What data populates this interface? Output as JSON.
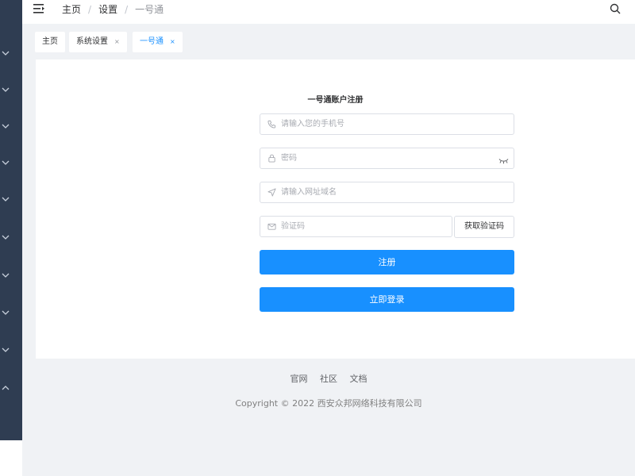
{
  "header": {
    "breadcrumb": [
      "主页",
      "设置",
      "一号通"
    ],
    "separator": "/"
  },
  "tabs": [
    {
      "label": "主页",
      "closable": false
    },
    {
      "label": "系统设置",
      "closable": true,
      "close": "×"
    },
    {
      "label": "一号通",
      "closable": true,
      "close": "×",
      "active": true
    }
  ],
  "form": {
    "title": "一号通账户注册",
    "phone": {
      "placeholder": "请输入您的手机号",
      "value": ""
    },
    "password": {
      "placeholder": "密码",
      "value": ""
    },
    "domain": {
      "placeholder": "请输入网址域名",
      "value": ""
    },
    "code": {
      "placeholder": "验证码",
      "value": ""
    },
    "get_code_label": "获取验证码",
    "register_label": "注册",
    "login_label": "立即登录"
  },
  "footer": {
    "links": [
      "官网",
      "社区",
      "文档"
    ],
    "copyright": "Copyright © 2022 西安众邦网络科技有限公司"
  },
  "icons": {
    "menu": "menu-fold-icon",
    "search": "search-icon",
    "phone": "phone-icon",
    "lock": "lock-icon",
    "eye": "eye-closed-icon",
    "navigate": "navigation-icon",
    "mail": "mail-icon"
  },
  "colors": {
    "primary": "#1890ff",
    "sidebar": "#2f3d52",
    "background": "#f0f2f5"
  }
}
